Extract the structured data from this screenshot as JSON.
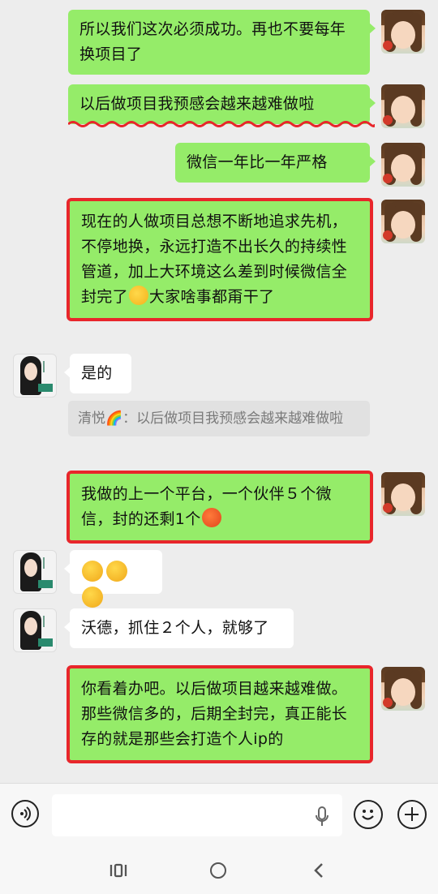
{
  "messages": [
    {
      "side": "self",
      "text": "所以我们这次必须成功。再也不要每年换项目了"
    },
    {
      "side": "self",
      "text": "以后做项目我预感会越来越难做啦"
    },
    {
      "side": "self",
      "text": "微信一年比一年严格"
    },
    {
      "side": "self",
      "text": "现在的人做项目总想不断地追求先机，不停地换，永远打造不出长久的持续性管道，加上大环境这么差到时候微信全封完了",
      "text_after_emoji": "大家啥事都甭干了",
      "emoji": "thinking-face"
    },
    {
      "side": "other",
      "text": "是的"
    },
    {
      "side": "quote",
      "text": "清悦🌈：以后做项目我预感会越来越难做啦"
    },
    {
      "side": "self",
      "text": "我做的上一个平台，一个伙伴５个微信，封的还剩1个",
      "emoji": "hot-face"
    },
    {
      "side": "other",
      "emoji": "laughing-tears ×3"
    },
    {
      "side": "other",
      "text": "沃德，抓住２个人，就够了"
    },
    {
      "side": "self",
      "text": "你看着办吧。以后做项目越来越难做。那些微信多的，后期全封完，真正能长存的就是那些会打造个人ip的"
    }
  ],
  "colors": {
    "self_bubble": "#95ec69",
    "other_bubble": "#ffffff",
    "highlight_border": "#e8262b",
    "background": "#ededed"
  },
  "input_bar": {
    "icons": [
      "voice-icon",
      "mic-icon",
      "emoji-icon",
      "plus-icon"
    ]
  },
  "nav_bar": {
    "icons": [
      "recents-icon",
      "home-icon",
      "back-icon"
    ]
  }
}
